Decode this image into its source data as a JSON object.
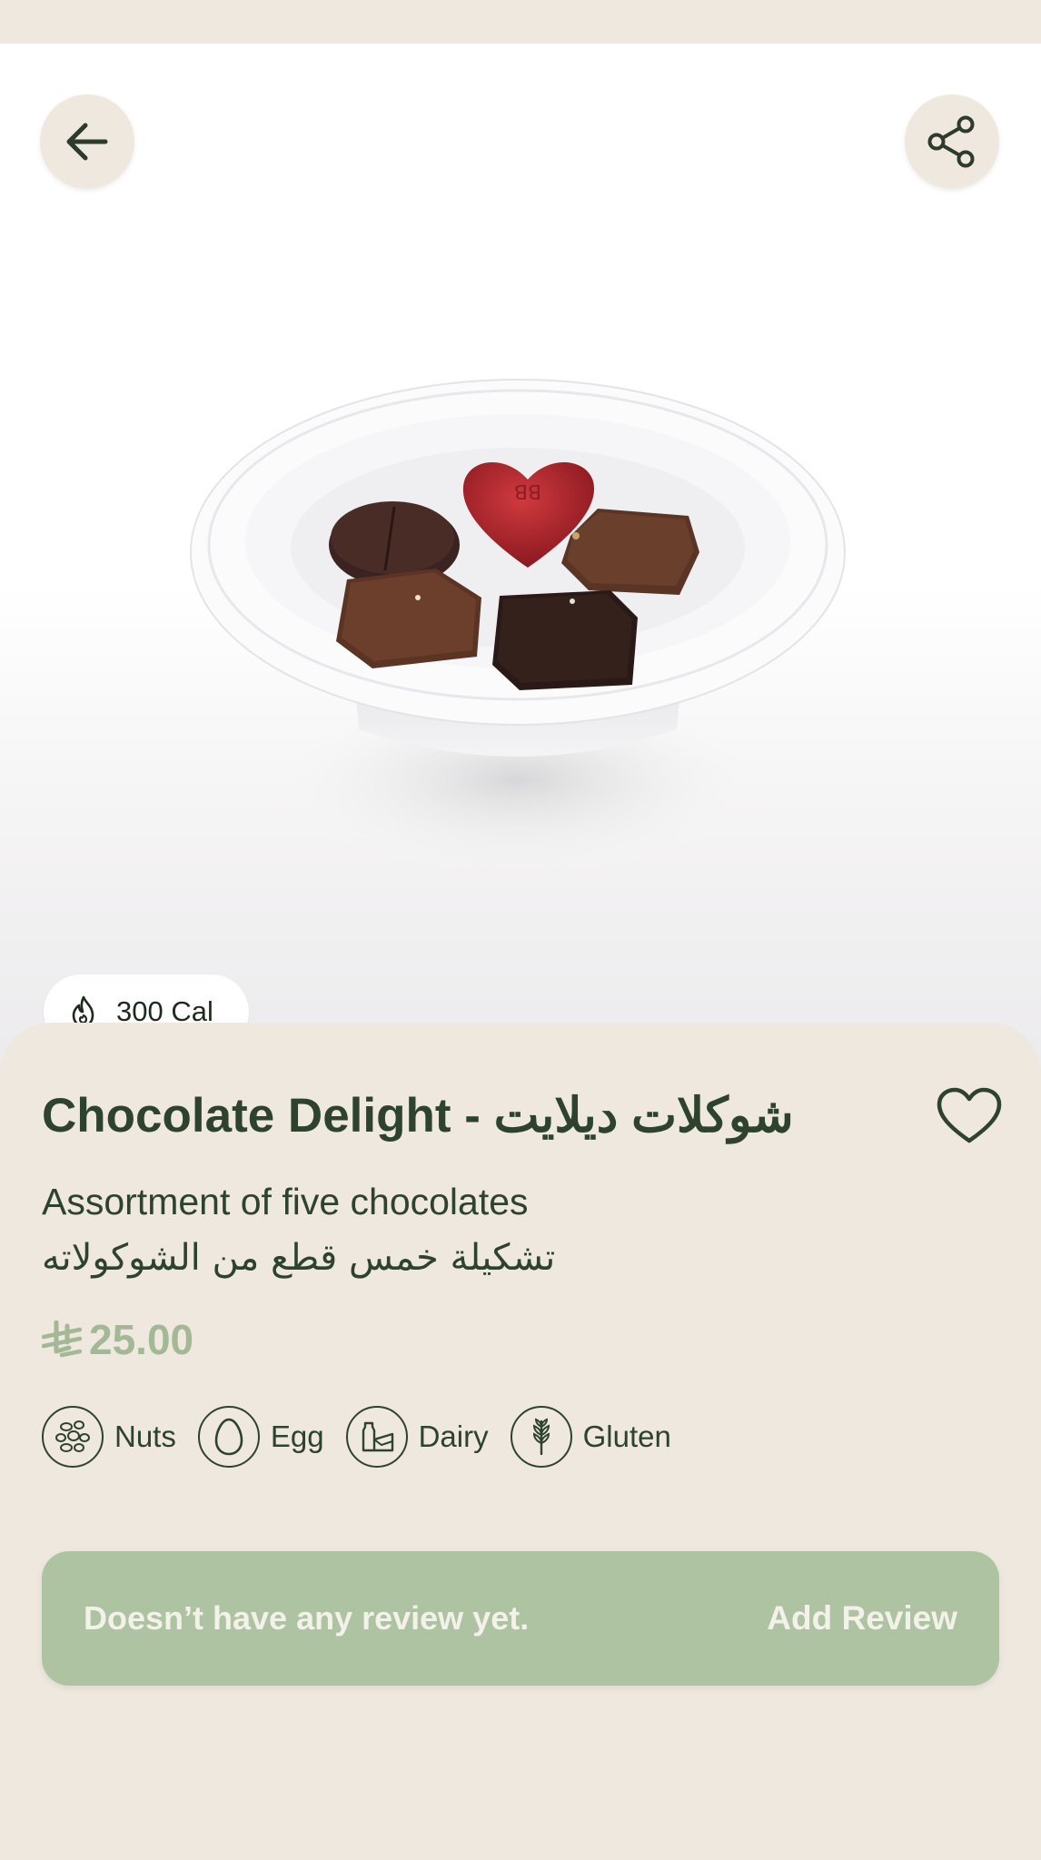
{
  "header": {
    "back_icon": "arrow-left-icon",
    "share_icon": "share-icon"
  },
  "product": {
    "calories": "300 Cal",
    "title": "Chocolate Delight - شوكلات ديلايت",
    "description_en": "Assortment of five chocolates",
    "description_ar": "تشكيلة خمس قطع من الشوكولاته",
    "price": "25.00",
    "currency_icon": "saudi-riyal-icon",
    "favorite_icon": "heart-outline-icon"
  },
  "allergens": [
    {
      "label": "Nuts",
      "icon": "nuts-icon"
    },
    {
      "label": "Egg",
      "icon": "egg-icon"
    },
    {
      "label": "Dairy",
      "icon": "dairy-icon"
    },
    {
      "label": "Gluten",
      "icon": "wheat-icon"
    }
  ],
  "reviews": {
    "empty_message": "Doesn’t have any review yet.",
    "add_label": "Add Review"
  },
  "colors": {
    "primary_dark": "#2d432e",
    "accent_green": "#adc3a1",
    "price_green": "#a3b996",
    "background": "#efe8de"
  }
}
